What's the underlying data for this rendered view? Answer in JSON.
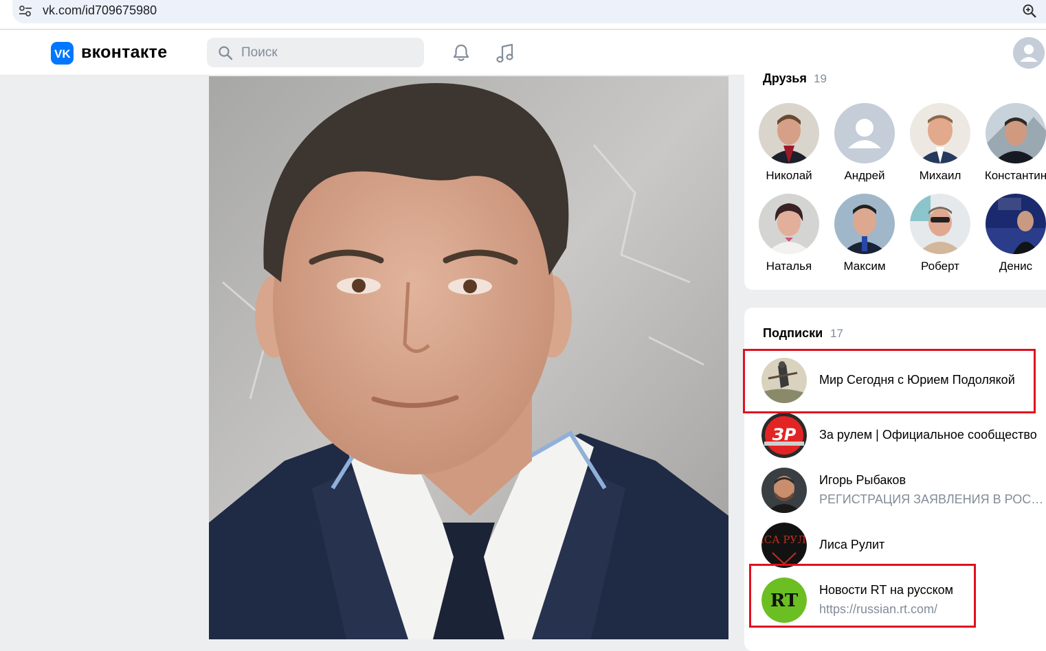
{
  "browser": {
    "url": "vk.com/id709675980",
    "site_info_icon": "tune-icon",
    "zoom_icon": "zoom-icon"
  },
  "header": {
    "logo_text": "ВКОНТАКТЕ",
    "search_placeholder": "Поиск",
    "icons": [
      "bell-icon",
      "music-icon",
      "user-avatar-icon"
    ],
    "accent": "#0077ff"
  },
  "friends": {
    "title": "Друзья",
    "count": "19",
    "items": [
      {
        "name": "Николай"
      },
      {
        "name": "Андрей"
      },
      {
        "name": "Михаил"
      },
      {
        "name": "Константин"
      },
      {
        "name": "Наталья"
      },
      {
        "name": "Максим"
      },
      {
        "name": "Роберт"
      },
      {
        "name": "Денис"
      }
    ]
  },
  "subscriptions": {
    "title": "Подписки",
    "count": "17",
    "items": [
      {
        "title": "Мир Сегодня с Юрием Подолякой",
        "subtitle": ""
      },
      {
        "title": "За рулем | Официальное сообщество",
        "subtitle": "",
        "logo_text": "ЗР"
      },
      {
        "title": "Игорь Рыбаков",
        "subtitle": "РЕГИСТРАЦИЯ ЗАЯВЛЕНИЯ В РОСКОМНАДЗОР"
      },
      {
        "title": "Лиса Рулит",
        "subtitle": "",
        "logo_text": "ЛИСА РУЛИТ"
      },
      {
        "title": "Новости RT на русском",
        "subtitle": "https://russian.rt.com/",
        "logo_text": "RT"
      }
    ]
  },
  "annotations": {
    "highlight_color": "#e0101f"
  }
}
